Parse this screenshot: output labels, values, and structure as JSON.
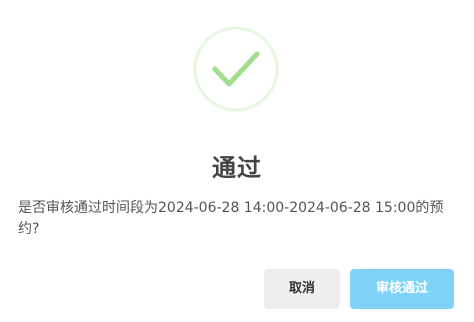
{
  "dialog": {
    "icon": "success-check-icon",
    "title": "通过",
    "message": "是否审核通过时间段为2024-06-28 14:00-2024-06-28 15:00的预约?",
    "cancel_label": "取消",
    "confirm_label": "审核通过"
  },
  "colors": {
    "icon_ring": "#e6f6e1",
    "icon_check": "#a3dd8f",
    "confirm_button": "#7fd3f7",
    "cancel_button": "#eeeeee"
  }
}
